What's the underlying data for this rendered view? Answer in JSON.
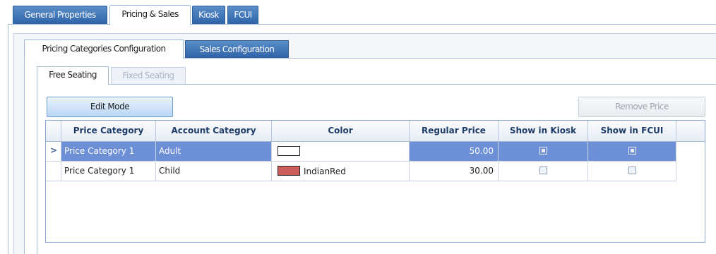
{
  "top_tabs": [
    {
      "label": "General Properties",
      "state": "inactive"
    },
    {
      "label": "Pricing & Sales",
      "state": "active"
    },
    {
      "label": "Kiosk",
      "state": "inactive"
    },
    {
      "label": "FCUI",
      "state": "inactive"
    }
  ],
  "sub_tabs": [
    {
      "label": "Pricing Categories Configuration",
      "state": "active"
    },
    {
      "label": "Sales Configuration",
      "state": "inactive"
    }
  ],
  "seating_tabs": [
    {
      "label": "Free Seating",
      "state": "active"
    },
    {
      "label": "Fixed Seating",
      "state": "disabled"
    }
  ],
  "toolbar": {
    "edit_mode_label": "Edit Mode",
    "remove_price_label": "Remove Price"
  },
  "grid": {
    "columns": [
      "Price Category",
      "Account Category",
      "Color",
      "Regular Price",
      "Show in Kiosk",
      "Show in FCUI"
    ],
    "row_indicator": ">",
    "rows": [
      {
        "price_category": "Price Category 1",
        "account_category": "Adult",
        "color_name": "",
        "color_hex": "#ffffff",
        "regular_price": "50.00",
        "show_in_kiosk": false,
        "show_in_fcui": false,
        "selected": true
      },
      {
        "price_category": "Price Category 1",
        "account_category": "Child",
        "color_name": "IndianRed",
        "color_hex": "#cd5c5c",
        "regular_price": "30.00",
        "show_in_kiosk": false,
        "show_in_fcui": false,
        "selected": false
      }
    ]
  },
  "colors": {
    "tab_inactive": "#3f74b8",
    "selection": "#6d8fd6",
    "header_text": "#1f3c68"
  }
}
